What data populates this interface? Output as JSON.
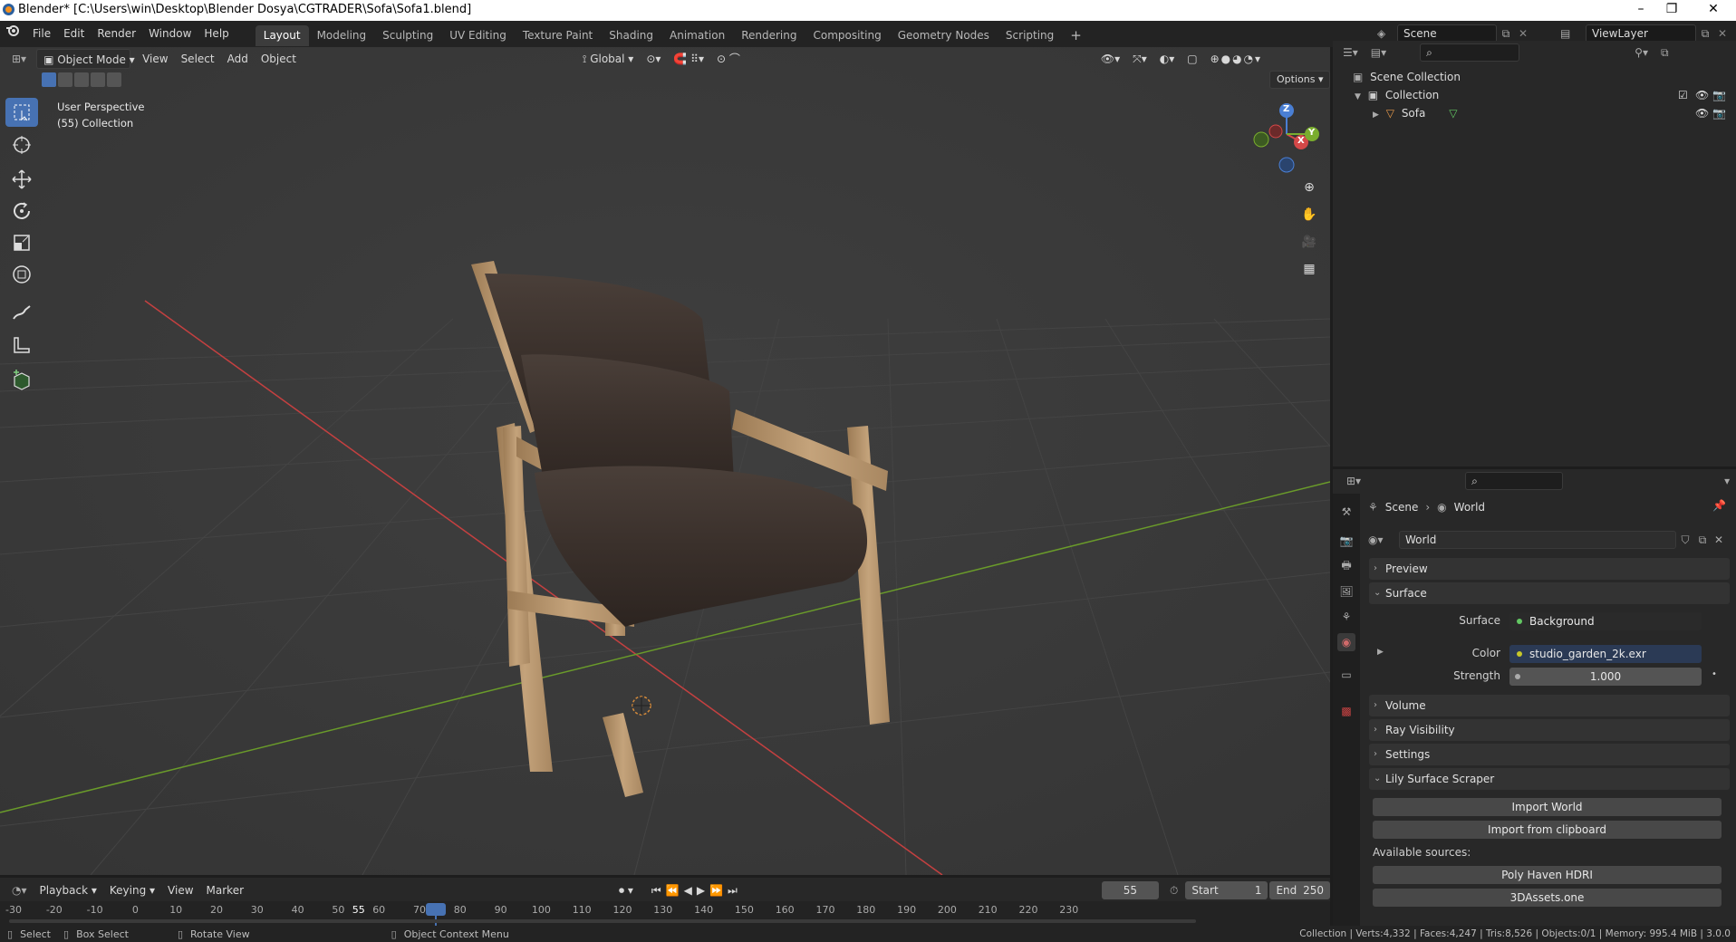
{
  "window": {
    "title": "Blender* [C:\\Users\\win\\Desktop\\Blender Dosya\\CGTRADER\\Sofa\\Sofa1.blend]",
    "minimize": "–",
    "maximize": "❐",
    "close": "✕"
  },
  "menu": {
    "items": [
      "File",
      "Edit",
      "Render",
      "Window",
      "Help"
    ],
    "workspaces": [
      "Layout",
      "Modeling",
      "Sculpting",
      "UV Editing",
      "Texture Paint",
      "Shading",
      "Animation",
      "Rendering",
      "Compositing",
      "Geometry Nodes",
      "Scripting"
    ],
    "active_workspace": "Layout",
    "add_workspace": "+",
    "scene": "Scene",
    "view_layer": "ViewLayer"
  },
  "viewport": {
    "mode": "Object Mode",
    "menus": [
      "View",
      "Select",
      "Add",
      "Object"
    ],
    "transform_orientation": "Global",
    "options_label": "Options",
    "overlay_title": "User Perspective",
    "overlay_subtitle": "(55) Collection",
    "gizmo_axes": {
      "z": "Z",
      "x": "X",
      "y": "Y"
    },
    "colors": {
      "background": "#393939",
      "x_axis": "#c44040",
      "y_axis": "#6a9b2a",
      "grid": "#444444",
      "active_tool": "#4772b3"
    }
  },
  "outliner": {
    "search_placeholder": "",
    "root": "Scene Collection",
    "collection": "Collection",
    "object": "Sofa"
  },
  "properties": {
    "search_placeholder": "",
    "breadcrumb": [
      "Scene",
      "World"
    ],
    "world_name": "World",
    "panels": {
      "preview": "Preview",
      "surface": "Surface",
      "volume": "Volume",
      "ray_visibility": "Ray Visibility",
      "settings": "Settings",
      "lily": "Lily Surface Scraper"
    },
    "surface_label": "Surface",
    "surface_value": "Background",
    "color_label": "Color",
    "color_value": "studio_garden_2k.exr",
    "strength_label": "Strength",
    "strength_value": "1.000",
    "lily": {
      "import_world": "Import World",
      "import_clipboard": "Import from clipboard",
      "available_sources": "Available sources:",
      "source1": "Poly Haven HDRI",
      "source2": "3DAssets.one"
    }
  },
  "timeline": {
    "menus": [
      "Playback",
      "Keying",
      "View",
      "Marker"
    ],
    "current_frame": "55",
    "start_label": "Start",
    "start_value": "1",
    "end_label": "End",
    "end_value": "250",
    "ticks": [
      "-30",
      "-20",
      "-10",
      "0",
      "10",
      "20",
      "30",
      "40",
      "50",
      "55",
      "60",
      "70",
      "80",
      "90",
      "100",
      "110",
      "120",
      "130",
      "140",
      "150",
      "160",
      "170",
      "180",
      "190",
      "200",
      "210",
      "220",
      "230"
    ]
  },
  "statusbar": {
    "select": "Select",
    "box_select": "Box Select",
    "rotate_view": "Rotate View",
    "context_menu": "Object Context Menu",
    "stats": "Collection | Verts:4,332 | Faces:4,247 | Tris:8,526 | Objects:0/1 | Memory: 995.4 MiB | 3.0.0"
  }
}
